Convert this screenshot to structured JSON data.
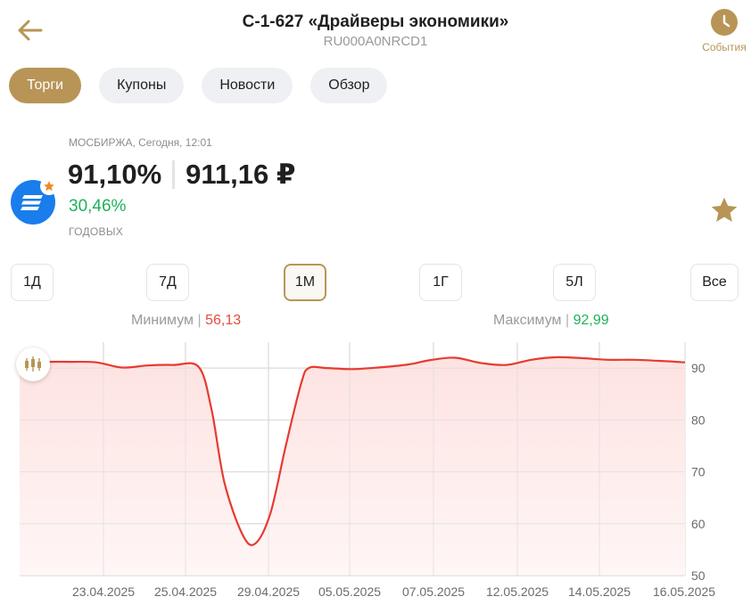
{
  "header": {
    "title": "С-1-627 «Драйверы экономики»",
    "isin": "RU000A0NRCD1",
    "events_label": "События",
    "back_icon": "arrow-left-icon",
    "events_icon": "clock-icon"
  },
  "tabs": [
    {
      "label": "Торги",
      "active": true
    },
    {
      "label": "Купоны",
      "active": false
    },
    {
      "label": "Новости",
      "active": false
    },
    {
      "label": "Обзор",
      "active": false
    }
  ],
  "quote": {
    "exchange": "МОСБИРЖА, Сегодня, 12:01",
    "price_percent": "91,10%",
    "price_rub": "911,16 ₽",
    "yield": "30,46%",
    "yield_label": "ГОДОВЫХ"
  },
  "periods": [
    {
      "label": "1Д",
      "active": false
    },
    {
      "label": "7Д",
      "active": false
    },
    {
      "label": "1М",
      "active": true
    },
    {
      "label": "1Г",
      "active": false
    },
    {
      "label": "5Л",
      "active": false
    },
    {
      "label": "Все",
      "active": false
    }
  ],
  "range": {
    "min_label": "Минимум",
    "min_value": "56,13",
    "max_label": "Максимум",
    "max_value": "92,99"
  },
  "colors": {
    "accent": "#b89556",
    "line": "#e63b30",
    "positive": "#1fb15a",
    "negative": "#e64a3c"
  },
  "chart_data": {
    "type": "area",
    "x": [
      "23.04.2025",
      "25.04.2025",
      "29.04.2025",
      "05.05.2025",
      "07.05.2025",
      "12.05.2025",
      "14.05.2025",
      "16.05.2025"
    ],
    "y_ticks": [
      90,
      80,
      70,
      60,
      50
    ],
    "ylim": [
      50,
      95
    ],
    "grid": true,
    "series": [
      {
        "points": [
          [
            0,
            91.1
          ],
          [
            0.55,
            91.2
          ],
          [
            1,
            91.2
          ],
          [
            1.5,
            91.1
          ],
          [
            2,
            90.1
          ],
          [
            2.5,
            90.5
          ],
          [
            3,
            90.6
          ],
          [
            3.5,
            90.2
          ],
          [
            3.75,
            82
          ],
          [
            4,
            68
          ],
          [
            4.35,
            58
          ],
          [
            4.6,
            56.13
          ],
          [
            4.9,
            62
          ],
          [
            5.2,
            75
          ],
          [
            5.5,
            87
          ],
          [
            5.65,
            90.0
          ],
          [
            6,
            90.0
          ],
          [
            6.5,
            89.8
          ],
          [
            7,
            90.1
          ],
          [
            7.6,
            90.7
          ],
          [
            8,
            91.5
          ],
          [
            8.5,
            92.0
          ],
          [
            9,
            91.0
          ],
          [
            9.5,
            90.6
          ],
          [
            10,
            91.6
          ],
          [
            10.5,
            92.1
          ],
          [
            11,
            91.9
          ],
          [
            11.5,
            91.6
          ],
          [
            12,
            91.6
          ],
          [
            12.5,
            91.4
          ],
          [
            13,
            91.1
          ]
        ]
      }
    ]
  }
}
